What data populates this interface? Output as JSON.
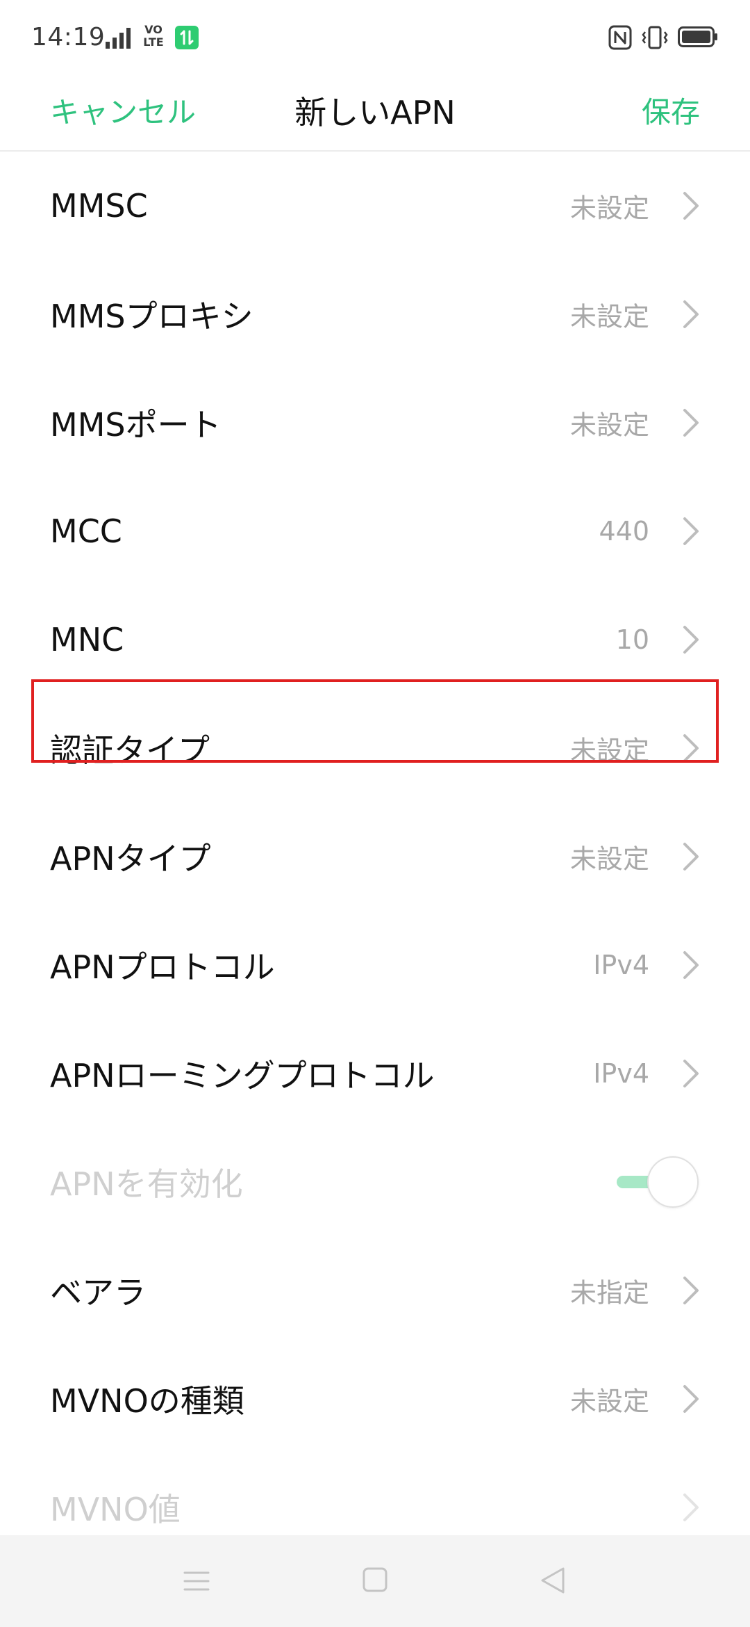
{
  "status_bar": {
    "time": "14:19",
    "volte_label_top": "VO",
    "volte_label_bottom": "LTE",
    "icons": [
      "signal-icon",
      "volte-icon",
      "data-icon",
      "nfc-icon",
      "vibrate-icon",
      "battery-icon"
    ]
  },
  "header": {
    "cancel_label": "キャンセル",
    "title": "新しいAPN",
    "save_label": "保存"
  },
  "colors": {
    "accent": "#2ec27e",
    "highlight_border": "#e02020",
    "value_text": "#a8a8a8",
    "disabled_text": "#cfcfcf",
    "nav_bg": "#f4f4f4"
  },
  "settings": [
    {
      "label": "MMSC",
      "value": "未設定"
    },
    {
      "label": "MMSプロキシ",
      "value": "未設定"
    },
    {
      "label": "MMSポート",
      "value": "未設定"
    },
    {
      "label": "MCC",
      "value": "440"
    },
    {
      "label": "MNC",
      "value": "10"
    },
    {
      "label": "認証タイプ",
      "value": "未設定",
      "highlighted": true
    },
    {
      "label": "APNタイプ",
      "value": "未設定"
    },
    {
      "label": "APNプロトコル",
      "value": "IPv4"
    },
    {
      "label": "APNローミングプロトコル",
      "value": "IPv4"
    },
    {
      "label": "APNを有効化",
      "toggle": true,
      "toggle_on": true,
      "disabled": true
    },
    {
      "label": "ベアラ",
      "value": "未指定"
    },
    {
      "label": "MVNOの種類",
      "value": "未設定"
    },
    {
      "label": "MVNO値",
      "value": "",
      "disabled": true
    }
  ],
  "nav_bar": {
    "icons": [
      "menu-icon",
      "home-icon",
      "back-icon"
    ]
  }
}
